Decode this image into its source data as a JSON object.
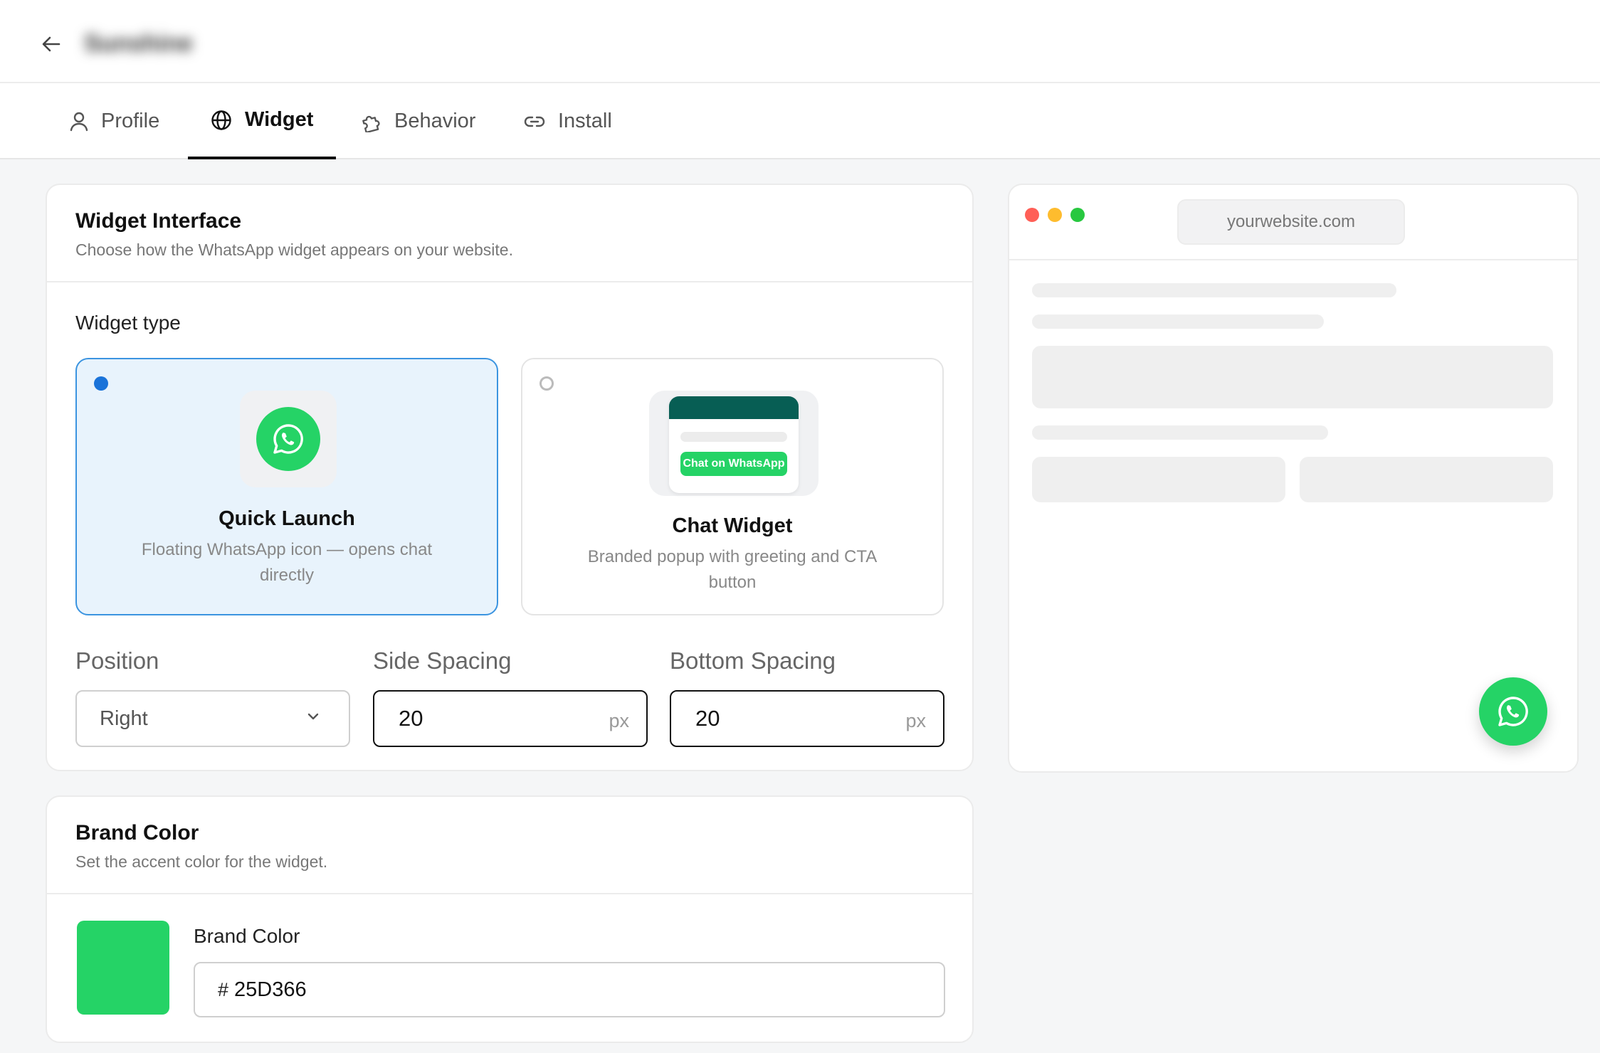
{
  "header": {
    "app_name": "Sunshine"
  },
  "tabs": [
    {
      "label": "Profile",
      "icon": "user-icon"
    },
    {
      "label": "Widget",
      "icon": "globe-icon",
      "active": true
    },
    {
      "label": "Behavior",
      "icon": "puzzle-icon"
    },
    {
      "label": "Install",
      "icon": "link-icon"
    }
  ],
  "interface_card": {
    "title": "Widget Interface",
    "subtitle": "Choose how the WhatsApp widget appears on your website.",
    "widget_type_label": "Widget type",
    "types": [
      {
        "title": "Quick Launch",
        "desc": "Floating WhatsApp icon — opens chat directly",
        "selected": true
      },
      {
        "title": "Chat Widget",
        "desc": "Branded popup with greeting and CTA button",
        "selected": false,
        "cta_label": "Chat on WhatsApp"
      }
    ],
    "position": {
      "label": "Position",
      "value": "Right"
    },
    "side_spacing": {
      "label": "Side Spacing",
      "value": "20",
      "unit": "px"
    },
    "bottom_spacing": {
      "label": "Bottom Spacing",
      "value": "20",
      "unit": "px"
    }
  },
  "brand_card": {
    "title": "Brand Color",
    "subtitle": "Set the accent color for the widget.",
    "field_label": "Brand Color",
    "hash": "#",
    "value": "25D366"
  },
  "preview": {
    "url": "yourwebsite.com",
    "dot_colors": [
      "#ff5f57",
      "#febc2e",
      "#28c840"
    ]
  },
  "colors": {
    "brand": "#25D366",
    "whatsapp_dark": "#075E54",
    "selected_bg": "#e8f3fc",
    "selected_border": "#3b94e0"
  }
}
